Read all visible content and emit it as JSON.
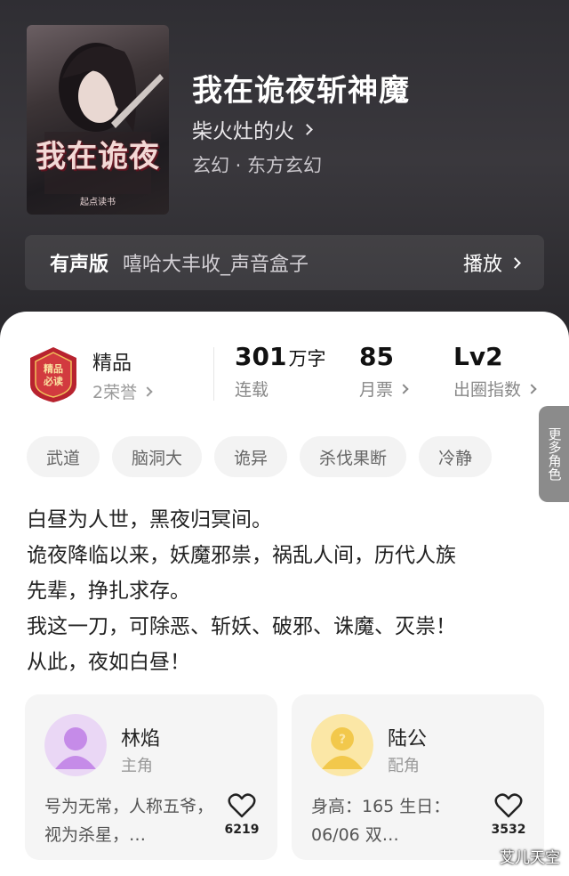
{
  "book": {
    "cover_title": "我在诡夜",
    "cover_publisher": "起点读书",
    "title": "我在诡夜斩神魔",
    "author": "柴火灶的火",
    "genre": "玄幻 · 东方玄幻"
  },
  "audio": {
    "label": "有声版",
    "name": "嘻哈大丰收_声音盒子",
    "play_label": "播放"
  },
  "stats": {
    "honor_label": "精品",
    "honor_sub": "2荣誉",
    "badge_text": "精品 必读",
    "word_count_value": "301",
    "word_count_unit": "万字",
    "word_count_label": "连载",
    "monthly_ticket_value": "85",
    "monthly_ticket_label": "月票",
    "influence_value": "Lv2",
    "influence_label": "出圈指数"
  },
  "tags": [
    "武道",
    "脑洞大",
    "诡异",
    "杀伐果断",
    "冷静"
  ],
  "synopsis": [
    "白昼为人世，黑夜归冥间。",
    "诡夜降临以来，妖魔邪祟，祸乱人间，历代人族",
    "先辈，挣扎求存。",
    "我这一刀，可除恶、斩妖、破邪、诛魔、灭祟！",
    "从此，夜如白昼！"
  ],
  "characters": [
    {
      "name": "林焰",
      "role": "主角",
      "desc": "号为无常，人称五爷，视为杀星，…",
      "likes": "6219"
    },
    {
      "name": "陆公",
      "role": "配角",
      "desc": "身高：165 生日：06/06 双…",
      "likes": "3532"
    }
  ],
  "more_roles": "更多角色",
  "watermark": "艾儿天空",
  "colors": {
    "header_bg": "#2f2e33",
    "panel_bg": "#ffffff",
    "tag_bg": "#f3f3f3",
    "badge_red": "#b8232f",
    "lead_avatar": "#c58be8",
    "support_avatar": "#f2c84b"
  }
}
